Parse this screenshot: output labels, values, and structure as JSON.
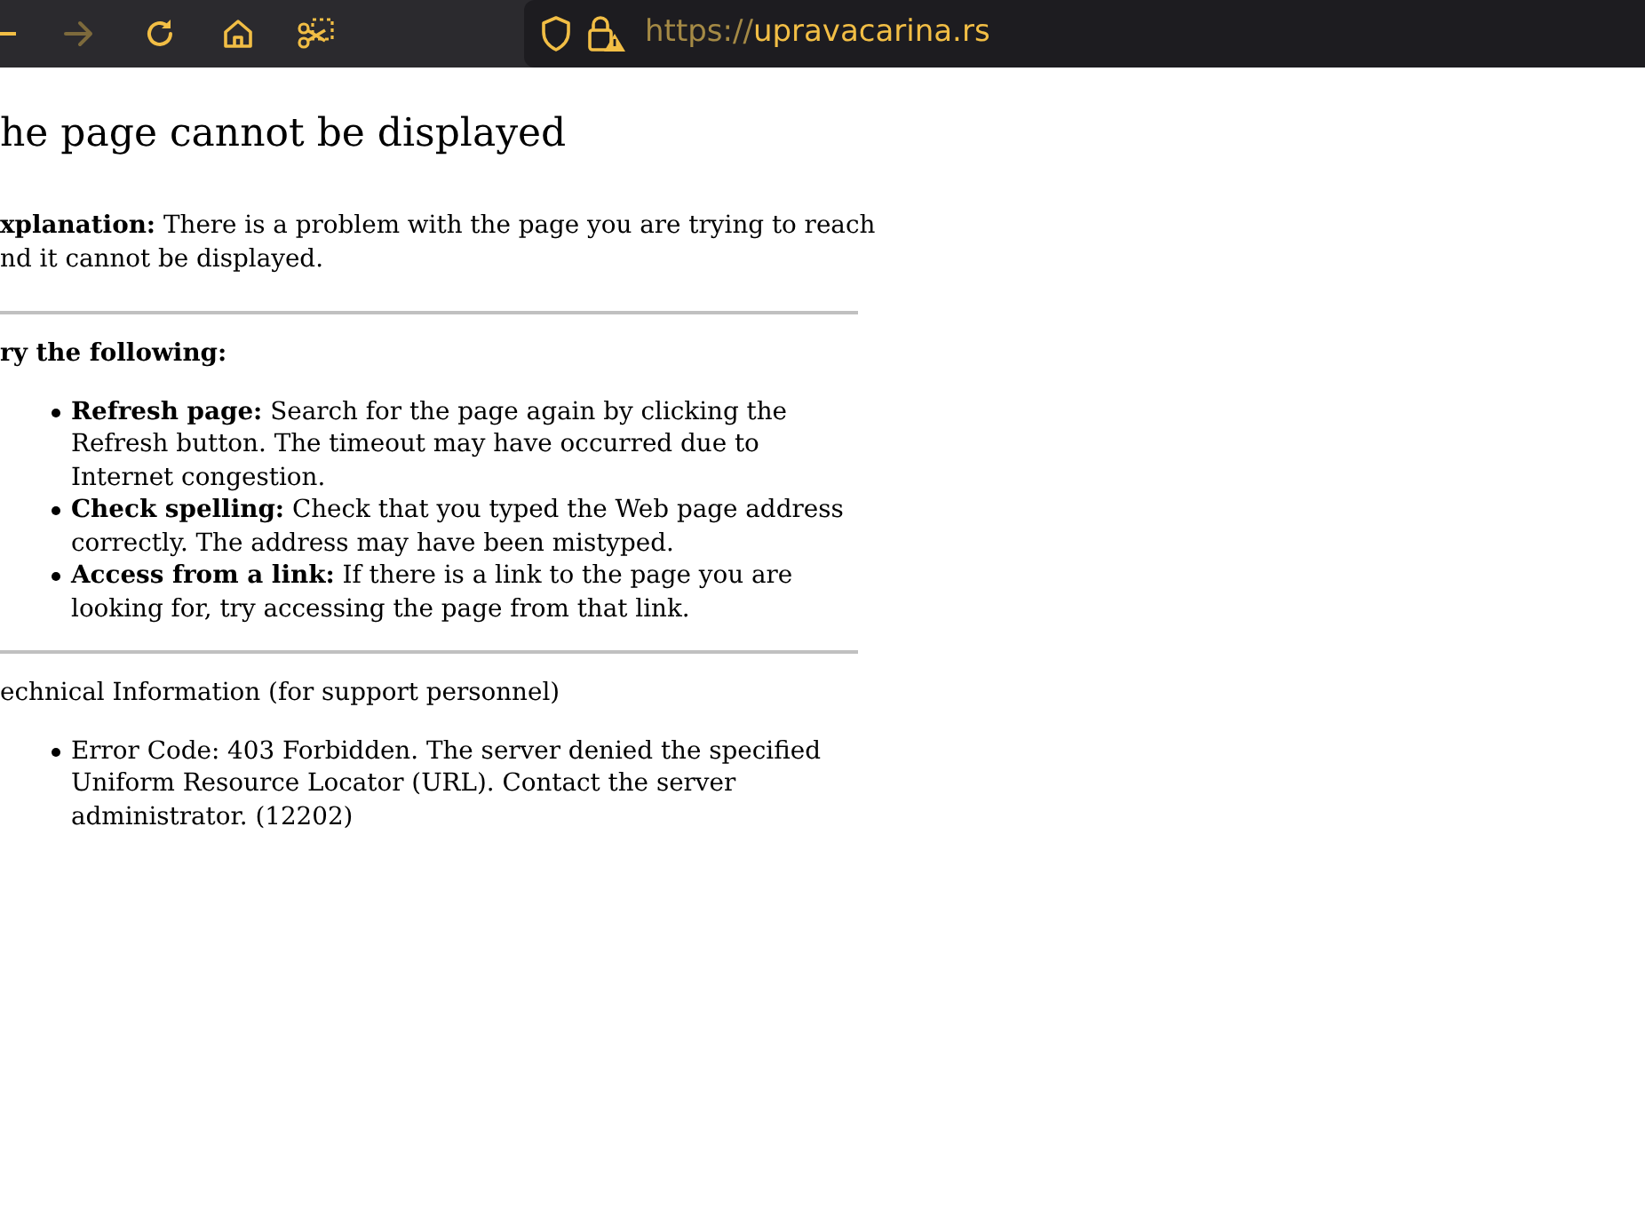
{
  "toolbar": {
    "buttons": [
      {
        "kind": "back",
        "disabled": false
      },
      {
        "kind": "forward",
        "disabled": true
      },
      {
        "kind": "reload",
        "disabled": false
      },
      {
        "kind": "home",
        "disabled": false
      },
      {
        "kind": "screenshot",
        "disabled": false
      }
    ]
  },
  "address_bar": {
    "scheme": "https://",
    "host": "upravacarina.rs",
    "insecure": true
  },
  "page": {
    "heading": "he page cannot be displayed",
    "explanation_lines": [
      "**xplanation:** There is a problem with the page you are trying to reach",
      "nd it cannot be displayed."
    ],
    "try_heading": "ry the following:",
    "suggestions": [
      "**Refresh page:** Search for the page again by clicking the Refresh button. The timeout may have occurred due to Internet congestion.",
      "**Check spelling:** Check that you typed the Web page address correctly. The address may have been mistyped.",
      "**Access from a link:** If there is a link to the page you are looking for, try accessing the page from that link."
    ],
    "technical_heading": "echnical Information (for support personnel)",
    "technical_items": [
      "Error Code: 403 Forbidden. The server denied the specified Uniform Resource Locator (URL). Contact the server administrator. (12202)"
    ]
  }
}
